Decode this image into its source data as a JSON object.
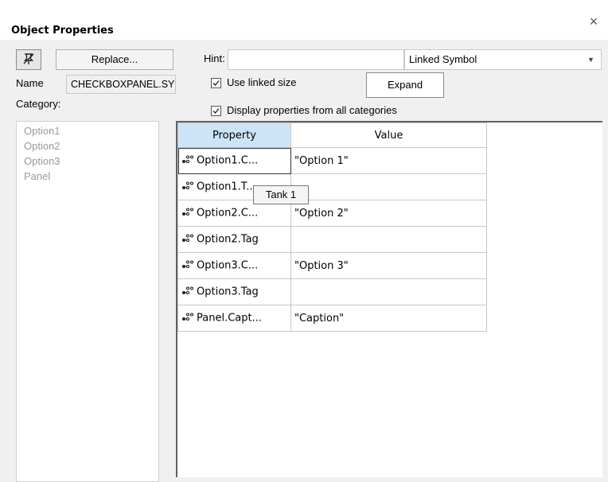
{
  "window": {
    "title": "Object Properties",
    "close_glyph": "×"
  },
  "toolbar": {
    "pin_icon": "pin-icon",
    "replace_label": "Replace...",
    "hint_label": "Hint:",
    "hint_value": "",
    "type_selected": "Linked Symbol"
  },
  "name": {
    "label": "Name",
    "value": "CHECKBOXPANEL.SY"
  },
  "options": {
    "use_linked_size": {
      "label": "Use linked size",
      "checked": true
    },
    "display_all": {
      "label": "Display properties from all categories",
      "checked": true
    },
    "expand_label": "Expand"
  },
  "category": {
    "label": "Category:",
    "items": [
      "Option1",
      "Option2",
      "Option3",
      "Panel"
    ]
  },
  "grid": {
    "headers": {
      "property": "Property",
      "value": "Value"
    },
    "rows": [
      {
        "property": "Option1.C...",
        "value": "\"Option 1\""
      },
      {
        "property": "Option1.T...",
        "value": ""
      },
      {
        "property": "Option2.C...",
        "value": "\"Option 2\""
      },
      {
        "property": "Option2.Tag",
        "value": ""
      },
      {
        "property": "Option3.C...",
        "value": "\"Option 3\""
      },
      {
        "property": "Option3.Tag",
        "value": ""
      },
      {
        "property": "Panel.Capt...",
        "value": "\"Caption\""
      }
    ]
  },
  "tooltip": {
    "text": "Tank 1"
  },
  "colors": {
    "header_selected": "#cce4f7",
    "category_text": "#9a9a9a"
  }
}
